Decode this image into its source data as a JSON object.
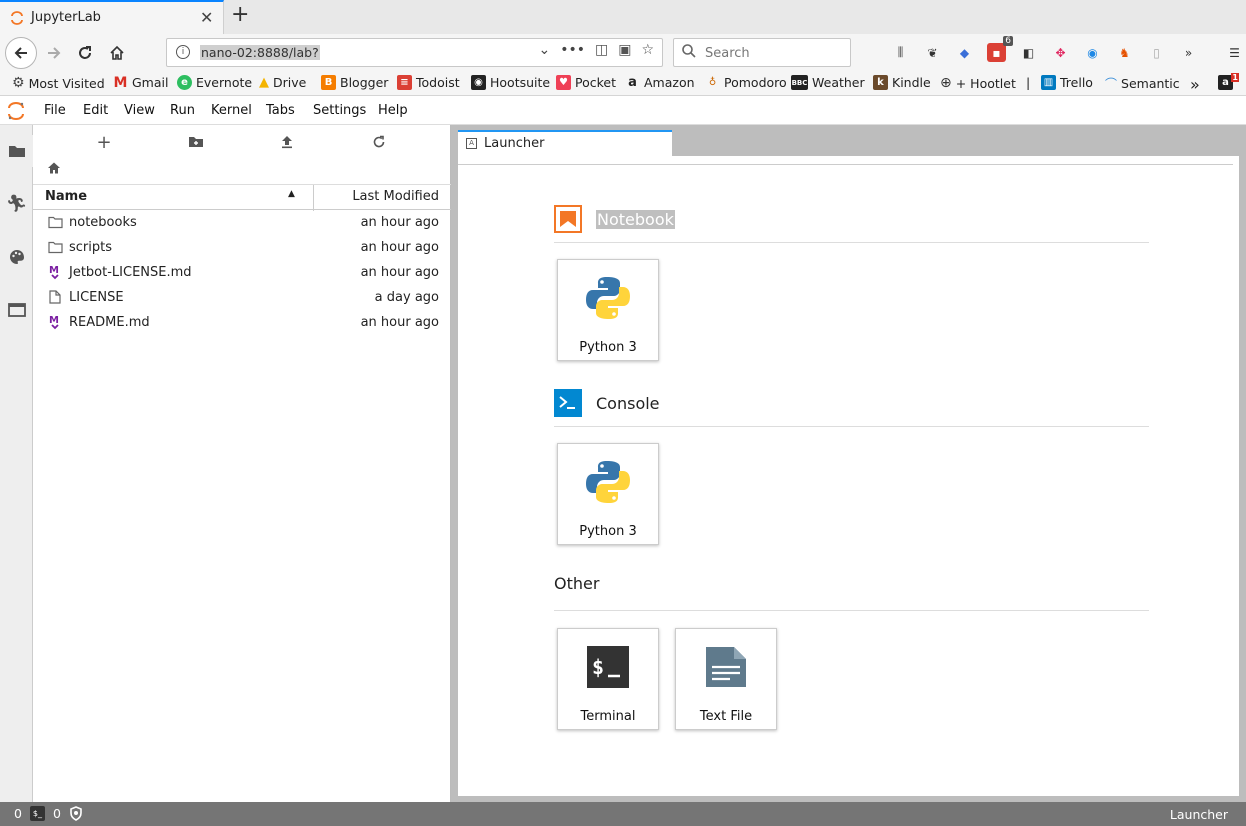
{
  "browser": {
    "tab_title": "JupyterLab",
    "url": "nano-02:8888/lab?",
    "search_placeholder": "Search",
    "ext_badge": "6",
    "bookmarks": [
      {
        "label": "Most Visited",
        "icon": "gear-icon"
      },
      {
        "label": "Gmail",
        "icon": "gmail-icon"
      },
      {
        "label": "Evernote",
        "icon": "evernote-icon"
      },
      {
        "label": "Drive",
        "icon": "drive-icon"
      },
      {
        "label": "Blogger",
        "icon": "blogger-icon"
      },
      {
        "label": "Todoist",
        "icon": "todoist-icon"
      },
      {
        "label": "Hootsuite",
        "icon": "hootsuite-icon"
      },
      {
        "label": "Pocket",
        "icon": "pocket-icon"
      },
      {
        "label": "Amazon",
        "icon": "amazon-icon"
      },
      {
        "label": "Pomodoro",
        "icon": "pomodoro-icon"
      },
      {
        "label": "Weather",
        "icon": "bbc-icon"
      },
      {
        "label": "Kindle",
        "icon": "kindle-icon"
      },
      {
        "label": "+ Hootlet",
        "icon": "globe-icon"
      },
      {
        "label": "|",
        "icon": ""
      },
      {
        "label": "Trello",
        "icon": "trello-icon"
      },
      {
        "label": "Semantic",
        "icon": "semantic-icon"
      }
    ],
    "bookmarks_overflow_badge": "1"
  },
  "jupyter": {
    "menu": [
      "File",
      "Edit",
      "View",
      "Run",
      "Kernel",
      "Tabs",
      "Settings",
      "Help"
    ],
    "filebrowser": {
      "col_name": "Name",
      "col_modified": "Last Modified",
      "files": [
        {
          "name": "notebooks",
          "modified": "an hour ago",
          "type": "folder"
        },
        {
          "name": "scripts",
          "modified": "an hour ago",
          "type": "folder"
        },
        {
          "name": "Jetbot-LICENSE.md",
          "modified": "an hour ago",
          "type": "markdown"
        },
        {
          "name": "LICENSE",
          "modified": "a day ago",
          "type": "file"
        },
        {
          "name": "README.md",
          "modified": "an hour ago",
          "type": "markdown"
        }
      ]
    },
    "launcher": {
      "tab_label": "Launcher",
      "notebook_title": "Notebook",
      "notebook_kernel": "Python 3",
      "console_title": "Console",
      "console_kernel": "Python 3",
      "other_title": "Other",
      "terminal_label": "Terminal",
      "textfile_label": "Text File"
    },
    "status": {
      "count1": "0",
      "count2": "0",
      "right": "Launcher"
    }
  },
  "colors": {
    "accent_blue": "#2196f3",
    "notebook_orange": "#f37726",
    "console_blue": "#0288d1",
    "statusbar": "#757575"
  }
}
